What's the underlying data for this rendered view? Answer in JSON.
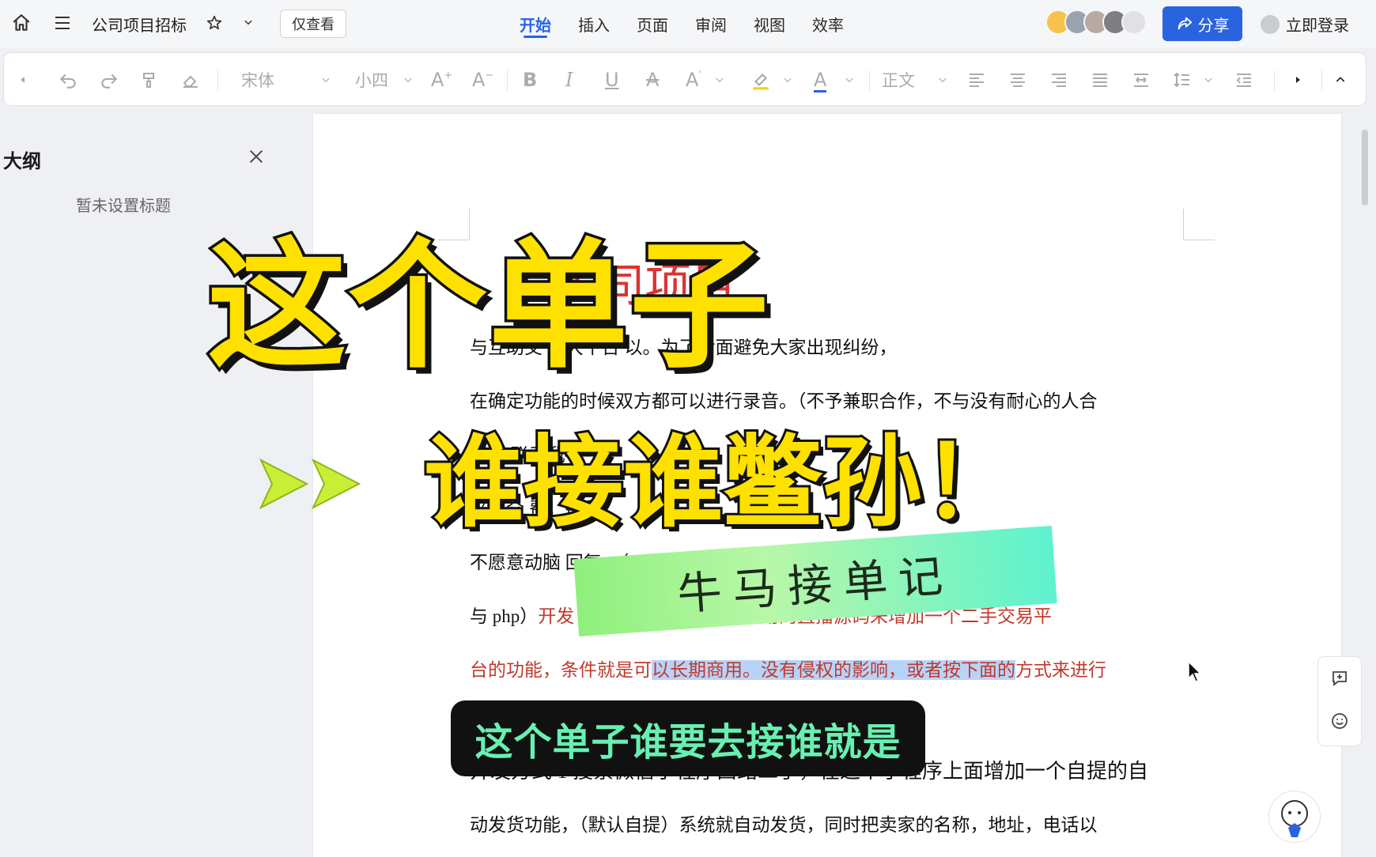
{
  "app": {
    "doc_title": "公司项目招标",
    "view_mode": "仅查看",
    "tabs": [
      "开始",
      "插入",
      "页面",
      "审阅",
      "视图",
      "效率"
    ],
    "active_tab": "开始",
    "share_label": "分享",
    "login_label": "立即登录",
    "accent": "#2a63e0"
  },
  "toolbar": {
    "font": "宋体",
    "size": "小四",
    "style": "正文"
  },
  "outline": {
    "title": "大纲",
    "empty": "暂未设置标题"
  },
  "document": {
    "heading": "d          司项目",
    "lines": [
      "    与互助交                                  的大平台    以。为了后面避免大家出现纠纷，",
      "在确定功能的时候双方都可以进行录音。（不予兼职合作，不与没有耐心的人合",
      "                                                                     适的    联系我",
      "                                                                   来有介    费，那种",
      "不愿意动脑                                                               回复，（uniapp",
      "与 php）",
      "开发         也有接收借可以长期商用的直播源码来增加一个二手交易平",
      "台的功能，条件就是可",
      "以长期商用。没有侵权的影响，或者按下面的",
      "方式来进行",
      "开发方式 1 搜索微信小程序西路二手，在这个小程序上面增加一个自提的自",
      "动发货功能，（默认自提）系统就自动发货，同时把卖家的名称，地址，电话以"
    ]
  },
  "overlay": {
    "headline_1": "这个单子",
    "headline_2": "谁接谁鳖孙！",
    "banner": "牛马接单记",
    "caption": "这个单子谁要去接谁就是",
    "headline_color": "#ffe100",
    "caption_color": "#68f0b2"
  }
}
